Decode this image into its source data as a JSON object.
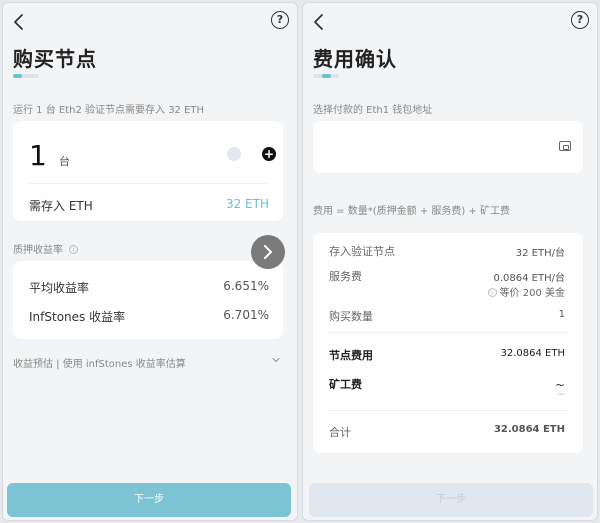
{
  "left": {
    "title": "购买节点",
    "intro": "运行 1 台 Eth2 验证节点需要存入 32 ETH",
    "quantity": {
      "value": "1",
      "unit": "台",
      "plus": "+"
    },
    "deposit": {
      "label": "需存入 ETH",
      "value": "32 ETH"
    },
    "staking_rate": {
      "section_label": "质押收益率",
      "info": "i",
      "rows": [
        {
          "label": "平均收益率",
          "value": "6.651%"
        },
        {
          "label": "InfStones 收益率",
          "value": "6.701%"
        }
      ]
    },
    "estimate": {
      "label": "收益预估 | 使用 infStones 收益率估算"
    },
    "next_label": "下一步",
    "help": "?"
  },
  "right": {
    "title": "费用确认",
    "wallet_label": "选择付款的 Eth1 钱包地址",
    "formula": "费用 = 数量*(质押金额 + 服务费) + 矿工费",
    "rows": {
      "deposit": {
        "label": "存入验证节点",
        "value": "32 ETH/台"
      },
      "service": {
        "label": "服务费",
        "value": "0.0864 ETH/台",
        "sub": "等价 200 美金",
        "info": "i"
      },
      "count": {
        "label": "购买数量",
        "value": "1"
      },
      "node_fee": {
        "label": "节点费用",
        "value": "32.0864 ETH"
      },
      "miner_fee": {
        "label": "矿工费",
        "value": "~",
        "value2": "~"
      },
      "total": {
        "label": "合计",
        "value": "32.0864 ETH"
      }
    },
    "next_label": "下一步",
    "help": "?"
  },
  "colors": {
    "accent": "#67c2d6",
    "button": "#7cc4d4",
    "button_disabled": "#e1e7ee"
  },
  "icons": [
    "back-arrow-icon",
    "help-icon",
    "minus-icon",
    "plus-icon",
    "info-icon",
    "chevron-down-icon",
    "chevron-right-icon",
    "wallet-icon"
  ]
}
